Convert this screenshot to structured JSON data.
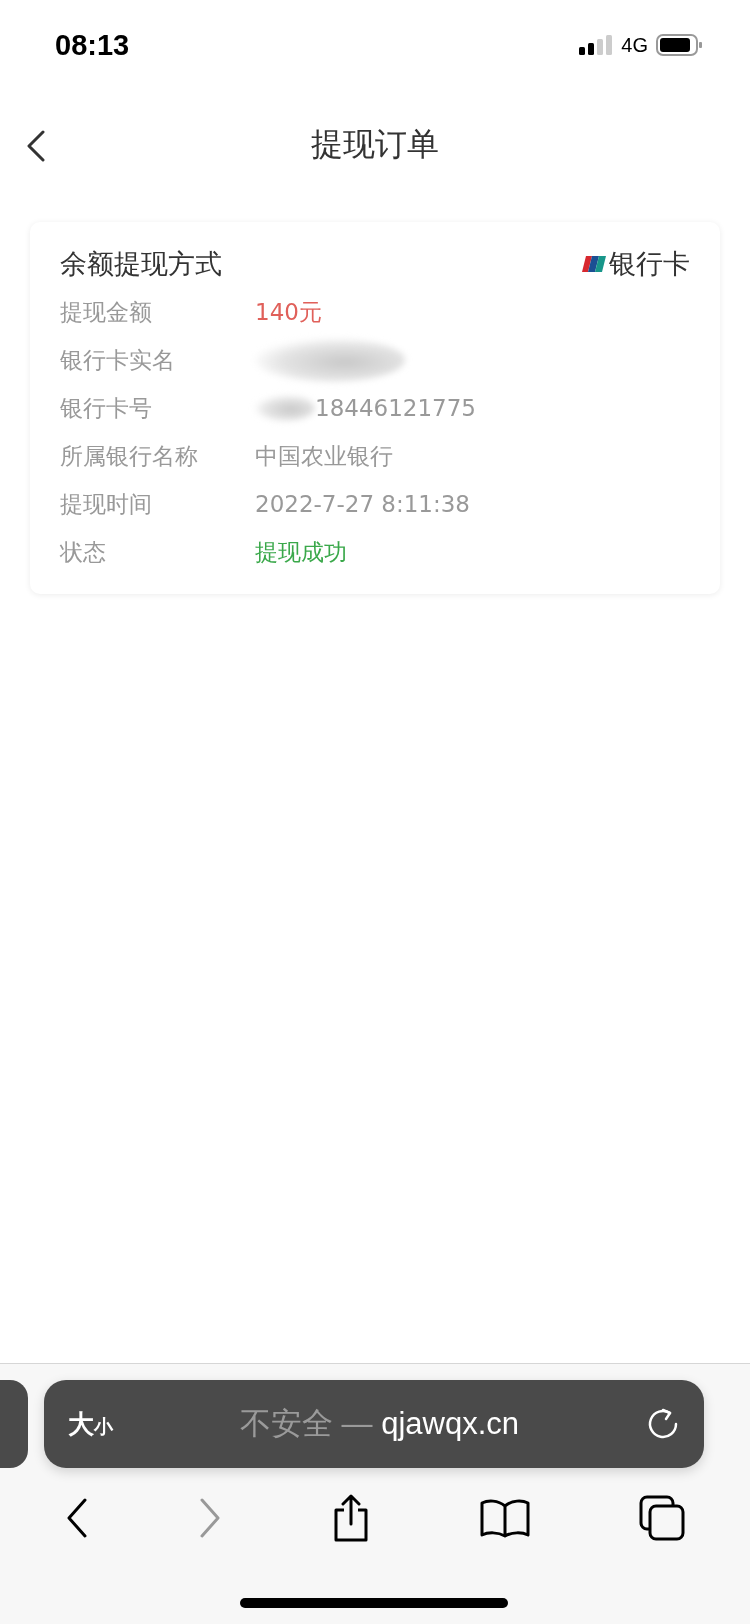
{
  "status_bar": {
    "time": "08:13",
    "network": "4G"
  },
  "header": {
    "title": "提现订单"
  },
  "card": {
    "title": "余额提现方式",
    "method": "银行卡",
    "rows": [
      {
        "label": "提现金额",
        "value": "140元",
        "kind": "amount"
      },
      {
        "label": "银行卡实名",
        "kind": "redacted"
      },
      {
        "label": "银行卡号",
        "value": "18446121775",
        "kind": "partly_redacted"
      },
      {
        "label": "所属银行名称",
        "value": "中国农业银行",
        "kind": "normal"
      },
      {
        "label": "提现时间",
        "value": "2022-7-27 8:11:38",
        "kind": "normal"
      },
      {
        "label": "状态",
        "value": "提现成功",
        "kind": "success"
      }
    ]
  },
  "browser": {
    "size_button": [
      "大",
      "小"
    ],
    "security": "不安全 —",
    "url": "qjawqx.cn",
    "nav": [
      {
        "kind": "back",
        "disabled": false
      },
      {
        "kind": "forward",
        "disabled": true
      }
    ]
  }
}
